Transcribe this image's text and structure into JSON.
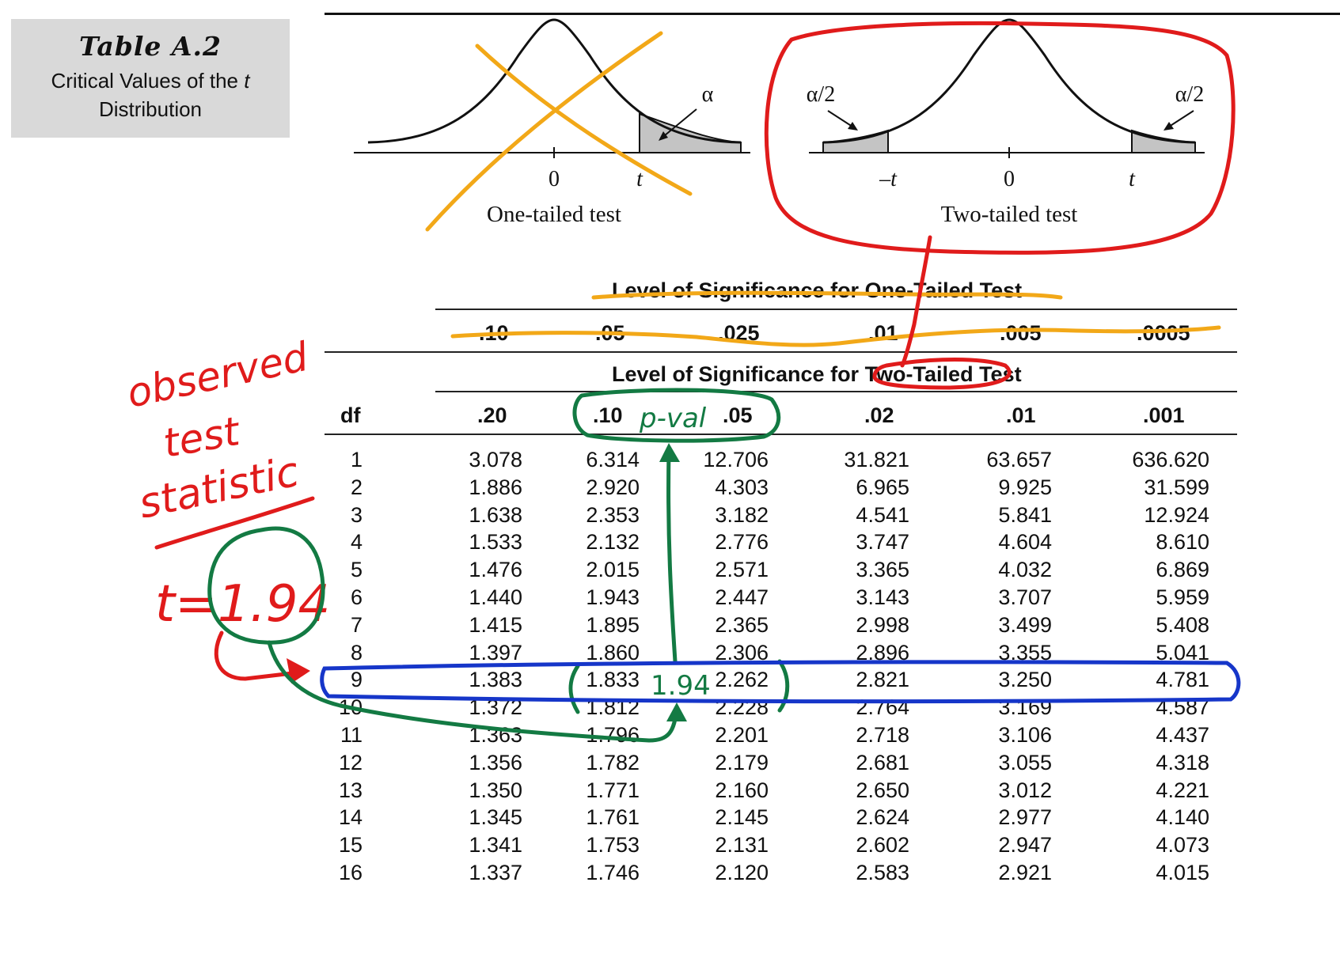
{
  "title": {
    "name": "Table A.2",
    "description_pre": "Critical Values of the ",
    "description_italic": "t",
    "description_post": " Distribution"
  },
  "diagrams": {
    "one_tailed": {
      "caption": "One-tailed test",
      "tail_label": "α",
      "zero": "0",
      "t": "t"
    },
    "two_tailed": {
      "caption": "Two-tailed test",
      "left_tail_label": "α/2",
      "right_tail_label": "α/2",
      "neg_t": "–t",
      "zero": "0",
      "t": "t"
    }
  },
  "headers": {
    "one_tailed_title": "Level of Significance for One-Tailed Test",
    "one_tailed_levels": [
      ".10",
      ".05",
      ".025",
      ".01",
      ".005",
      ".0005"
    ],
    "two_tailed_title": "Level of Significance for Two-Tailed Test",
    "df_label": "df",
    "two_tailed_levels": [
      ".20",
      ".10",
      ".05",
      ".02",
      ".01",
      ".001"
    ]
  },
  "rows": [
    {
      "df": "1",
      "v": [
        "3.078",
        "6.314",
        "12.706",
        "31.821",
        "63.657",
        "636.620"
      ]
    },
    {
      "df": "2",
      "v": [
        "1.886",
        "2.920",
        "4.303",
        "6.965",
        "9.925",
        "31.599"
      ]
    },
    {
      "df": "3",
      "v": [
        "1.638",
        "2.353",
        "3.182",
        "4.541",
        "5.841",
        "12.924"
      ]
    },
    {
      "df": "4",
      "v": [
        "1.533",
        "2.132",
        "2.776",
        "3.747",
        "4.604",
        "8.610"
      ]
    },
    {
      "df": "5",
      "v": [
        "1.476",
        "2.015",
        "2.571",
        "3.365",
        "4.032",
        "6.869"
      ]
    },
    {
      "df": "6",
      "v": [
        "1.440",
        "1.943",
        "2.447",
        "3.143",
        "3.707",
        "5.959"
      ]
    },
    {
      "df": "7",
      "v": [
        "1.415",
        "1.895",
        "2.365",
        "2.998",
        "3.499",
        "5.408"
      ]
    },
    {
      "df": "8",
      "v": [
        "1.397",
        "1.860",
        "2.306",
        "2.896",
        "3.355",
        "5.041"
      ]
    },
    {
      "df": "9",
      "v": [
        "1.383",
        "1.833",
        "2.262",
        "2.821",
        "3.250",
        "4.781"
      ]
    },
    {
      "df": "10",
      "v": [
        "1.372",
        "1.812",
        "2.228",
        "2.764",
        "3.169",
        "4.587"
      ]
    },
    {
      "df": "11",
      "v": [
        "1.363",
        "1.796",
        "2.201",
        "2.718",
        "3.106",
        "4.437"
      ]
    },
    {
      "df": "12",
      "v": [
        "1.356",
        "1.782",
        "2.179",
        "2.681",
        "3.055",
        "4.318"
      ]
    },
    {
      "df": "13",
      "v": [
        "1.350",
        "1.771",
        "2.160",
        "2.650",
        "3.012",
        "4.221"
      ]
    },
    {
      "df": "14",
      "v": [
        "1.345",
        "1.761",
        "2.145",
        "2.624",
        "2.977",
        "4.140"
      ]
    },
    {
      "df": "15",
      "v": [
        "1.341",
        "1.753",
        "2.131",
        "2.602",
        "2.947",
        "4.073"
      ]
    },
    {
      "df": "16",
      "v": [
        "1.337",
        "1.746",
        "2.120",
        "2.583",
        "2.921",
        "4.015"
      ]
    }
  ],
  "annotations": {
    "observed_lines": [
      "observed",
      "test",
      "statistic"
    ],
    "t_value": "t=1.94",
    "p_val": "p-val",
    "between_value": "1.94",
    "colors": {
      "red": "#e01b1b",
      "green": "#137a43",
      "blue": "#1636c9",
      "orange": "#f2a818"
    }
  }
}
